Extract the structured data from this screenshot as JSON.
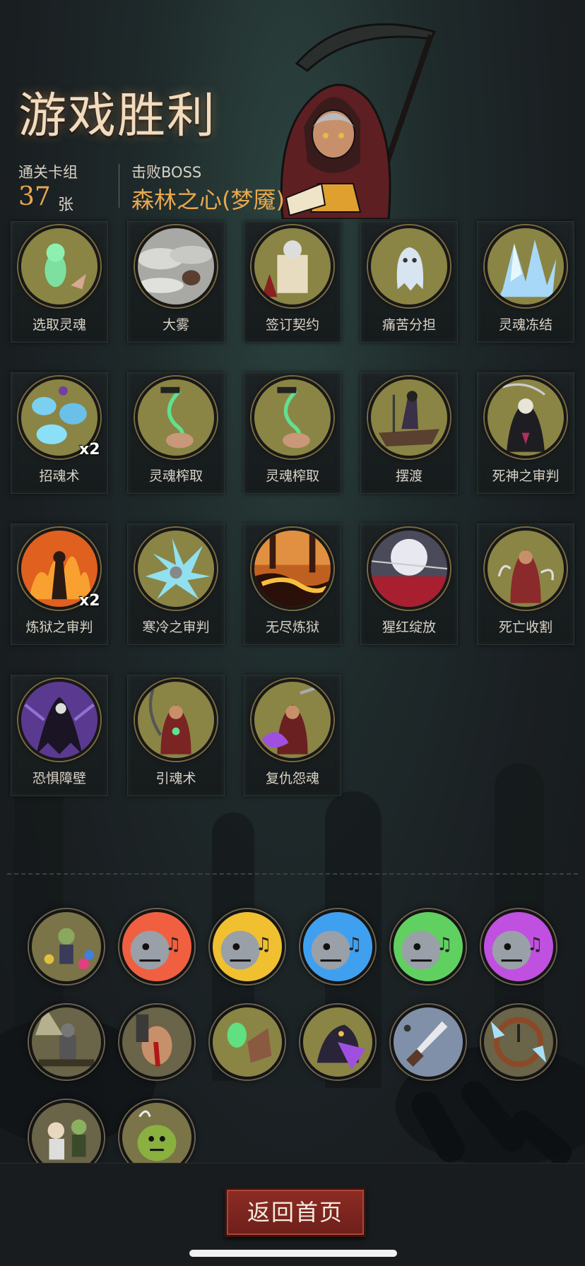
{
  "header": {
    "title": "游戏胜利",
    "deck_label": "通关卡组",
    "deck_count": "37",
    "deck_unit": "张",
    "boss_label": "击败BOSS",
    "boss_name": "森林之心(梦魇)"
  },
  "cards": [
    {
      "name": "选取灵魂",
      "badge": "",
      "art": "green-spirit"
    },
    {
      "name": "大雾",
      "badge": "",
      "art": "fog"
    },
    {
      "name": "签订契约",
      "badge": "",
      "art": "contract"
    },
    {
      "name": "痛苦分担",
      "badge": "",
      "art": "ghost"
    },
    {
      "name": "灵魂冻结",
      "badge": "",
      "art": "ice"
    },
    {
      "name": "招魂术",
      "badge": "x2",
      "art": "blue-souls"
    },
    {
      "name": "灵魂榨取",
      "badge": "",
      "art": "drain"
    },
    {
      "name": "灵魂榨取",
      "badge": "",
      "art": "drain"
    },
    {
      "name": "摆渡",
      "badge": "",
      "art": "ferry"
    },
    {
      "name": "死神之审判",
      "badge": "",
      "art": "reaper"
    },
    {
      "name": "炼狱之审判",
      "badge": "x2",
      "art": "fire-figure"
    },
    {
      "name": "寒冷之审判",
      "badge": "",
      "art": "ice-shards"
    },
    {
      "name": "无尽炼狱",
      "badge": "",
      "art": "lava"
    },
    {
      "name": "猩红绽放",
      "badge": "",
      "art": "red-moon"
    },
    {
      "name": "死亡收割",
      "badge": "",
      "art": "hood-girl"
    },
    {
      "name": "恐惧障壁",
      "badge": "",
      "art": "purple-reaper"
    },
    {
      "name": "引魂术",
      "badge": "",
      "art": "hood-scythe"
    },
    {
      "name": "复仇怨魂",
      "badge": "",
      "art": "purple-hood"
    }
  ],
  "relics": [
    {
      "icon": "party-zombie-icon"
    },
    {
      "icon": "red-flame-monster-icon"
    },
    {
      "icon": "yellow-flame-monster-icon"
    },
    {
      "icon": "blue-flame-monster-icon"
    },
    {
      "icon": "green-flame-monster-icon"
    },
    {
      "icon": "purple-flame-monster-icon"
    },
    {
      "icon": "spotlight-knight-icon"
    },
    {
      "icon": "bloody-hand-icon"
    },
    {
      "icon": "green-ghost-icon"
    },
    {
      "icon": "purple-beast-icon"
    },
    {
      "icon": "dagger-icon"
    },
    {
      "icon": "frozen-dial-icon"
    },
    {
      "icon": "scientist-zombie-icon"
    },
    {
      "icon": "green-ogre-icon"
    }
  ],
  "footer": {
    "home_button": "返回首页"
  },
  "colors": {
    "accent_gold": "#e8a84e",
    "button_red": "#8d2c24",
    "card_ring": "#7a6a40"
  }
}
